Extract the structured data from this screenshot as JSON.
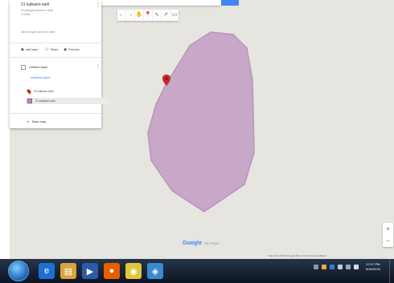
{
  "panel": {
    "title": "21 kulkarni-earli",
    "meta1": "all changes saved in drive",
    "meta2": "0 views",
    "edited": "last changes saved in drive",
    "more_icon": "more-vert-icon",
    "actions": [
      {
        "label": "add layer",
        "icon": "layer-plus-icon"
      },
      {
        "label": "Share",
        "icon": "person-add-icon"
      },
      {
        "label": "Preview",
        "icon": "eye-icon"
      }
    ],
    "layer": {
      "title": "Untitled layer",
      "sublabel": "Individual styles",
      "features": [
        {
          "label": "21 kulkarni-earli",
          "icon": "pin-icon"
        },
        {
          "label": "21 kulkarni-earli",
          "icon": "polygon-icon"
        }
      ]
    },
    "base_map": "Base map"
  },
  "toolbar": {
    "tools": [
      "undo-icon",
      "redo-icon",
      "hand-icon",
      "marker-icon",
      "line-icon",
      "directions-icon",
      "ruler-icon"
    ],
    "glyphs": [
      "←",
      "→",
      "✋",
      "📍",
      "∿",
      "↗",
      "▭"
    ]
  },
  "zoom": {
    "in": "+",
    "out": "−"
  },
  "logo": {
    "google": "Google",
    "sub": "My Maps"
  },
  "attribution": "Map data ©2016 Google   200 m   Terms   Send feedback",
  "colors": {
    "polygon_fill": "#c7a8c8",
    "polygon_stroke": "#b993bb",
    "marker": "#c62828",
    "accent": "#4285f4"
  },
  "taskbar": {
    "apps": [
      {
        "icon": "internet-explorer-icon",
        "glyph": "e",
        "bg": "#1f6fd1"
      },
      {
        "icon": "file-explorer-icon",
        "glyph": "▤",
        "bg": "#d9a441"
      },
      {
        "icon": "media-player-icon",
        "glyph": "▶",
        "bg": "#2b5aa8"
      },
      {
        "icon": "firefox-icon",
        "glyph": "●",
        "bg": "#e66000"
      },
      {
        "icon": "chrome-icon",
        "glyph": "◉",
        "bg": "#e0c63a"
      },
      {
        "icon": "app-icon",
        "glyph": "◈",
        "bg": "#3a8ad0"
      }
    ],
    "time": "12:07 PM",
    "date": "6/28/2016"
  }
}
